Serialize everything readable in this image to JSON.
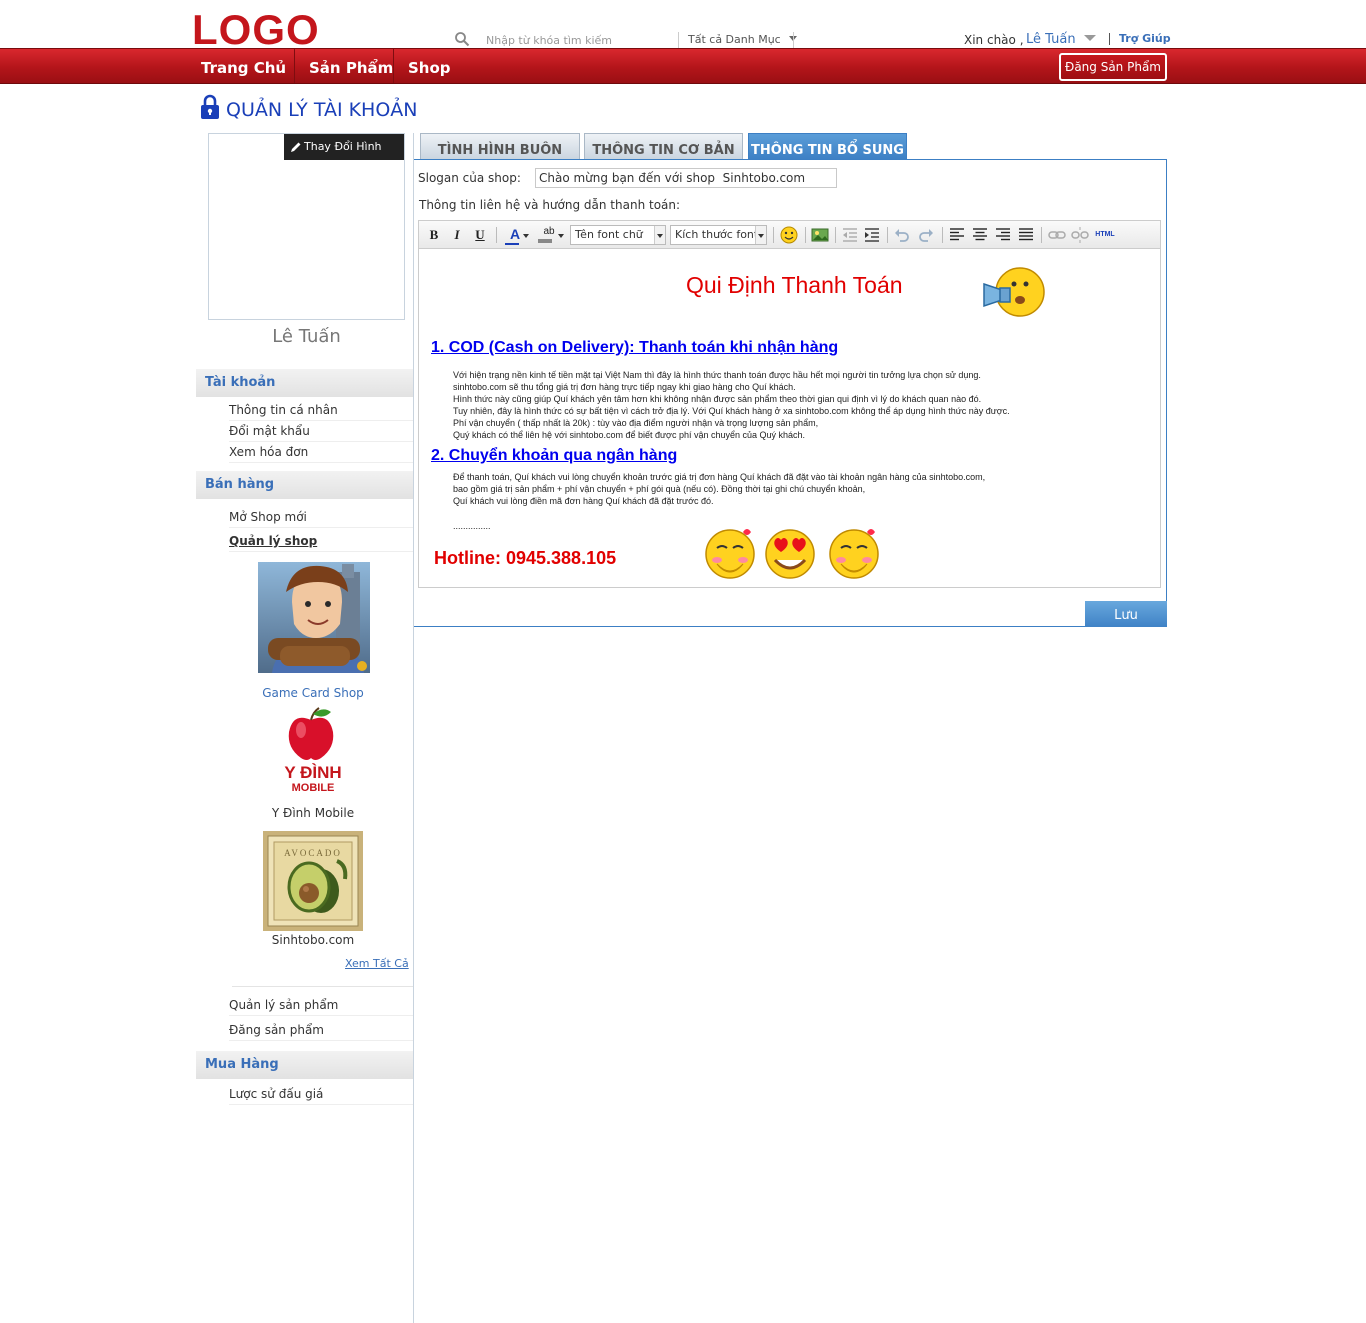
{
  "header": {
    "logo": "LOGO",
    "search_placeholder": "Nhập từ khóa tìm kiếm",
    "category": "Tất cả Danh Mục",
    "greeting": "Xin chào ,",
    "username": "Lê Tuấn",
    "help": "Trợ Giúp"
  },
  "nav": {
    "items": [
      "Trang Chủ",
      "Sản Phẩm",
      "Shop"
    ],
    "post_button": "Đăng Sản Phẩm"
  },
  "page_title": "QUẢN LÝ TÀI KHOẢN",
  "profile": {
    "change_photo": "Thay Đổi Hình Ảnh",
    "name": "Lê Tuấn"
  },
  "sidebar": {
    "account_head": "Tài khoản",
    "account_items": [
      "Thông tin cá nhân",
      "Đổi mật khẩu",
      "Xem hóa đơn"
    ],
    "sales_head": "Bán hàng",
    "sales_items": [
      "Mở Shop mới",
      "Quản lý shop"
    ],
    "shops": [
      {
        "name": "Game Card Shop",
        "color": "#3a6fb8"
      },
      {
        "name": "Y Đình Mobile",
        "color": "#333333",
        "logo_text": "Y ĐÌNH",
        "logo_sub": "MOBILE"
      },
      {
        "name": "Sinhtobo.com",
        "color": "#333333",
        "logo_text": "AVOCADO"
      }
    ],
    "see_all": "Xem Tất Cả",
    "sales_items_more": [
      "Quản lý sản phẩm",
      "Đăng sản phẩm"
    ],
    "buy_head": "Mua Hàng",
    "buy_items": [
      "Lược sử đấu giá"
    ]
  },
  "tabs": [
    "TÌNH HÌNH BUÔN BÁN",
    "THÔNG TIN CƠ BẢN",
    "THÔNG TIN BỔ SUNG"
  ],
  "form": {
    "slogan_label": "Slogan của shop:",
    "slogan_value": "Chào mừng bạn đến với shop  Sinhtobo.com",
    "contact_label": "Thông tin liên hệ và hướng dẫn thanh toán:"
  },
  "toolbar": {
    "bold": "B",
    "italic": "I",
    "underline": "U",
    "font_color": "A",
    "highlight": "ab",
    "font_name": "Tên font chữ",
    "font_size": "Kích thước font",
    "html": "HTML"
  },
  "document": {
    "title": "Qui Định Thanh Toán",
    "section1": "1. COD (Cash on Delivery):  Thanh toán khi nhận hàng",
    "section1_lines": [
      "  Với hiện trạng nền kinh tế tiền mặt tại Việt Nam thì đây là hình thức thanh toán được hầu hết mọi người tin tưởng lựa chọn sử dụng.",
      "sinhtobo.com sẽ thu tổng giá trị đơn hàng trực tiếp ngay khi giao hàng cho Quí khách.",
      "Hình thức này cũng giúp Quí khách yên tâm hơn khi không nhận được sản phẩm theo thời gian qui định vì lý do khách quan nào đó.",
      "Tuy nhiên, đây là hình thức có sự bất tiện vì cách trở địa lý. Với Quí khách hàng ở xa sinhtobo.com không thể áp dụng hình thức này được.",
      "Phí vận chuyển ( thấp nhất là 20k) : tùy vào địa điểm người nhận và trọng lượng sản phẩm,",
      "Quý khách có thể liên hệ với sinhtobo.com để biết được phí vận chuyển của Quý khách."
    ],
    "section2": "2. Chuyển khoản qua ngân hàng",
    "section2_lines": [
      "Để thanh toán, Quí khách vui lòng chuyển khoản trước giá trị đơn hàng Quí khách đã đặt vào tài khoản ngân hàng của sinhtobo.com,",
      "bao gồm giá trị sản phẩm + phí vận chuyển + phí gói quà (nếu có). Đồng thời tại ghi chú chuyển khoản,",
      "Quí khách vui lòng điền mã đơn hàng Quí khách đã đặt trước đó."
    ],
    "ellipsis": "...............",
    "hotline": "Hotline: 0945.388.105"
  },
  "save_button": "Lưu",
  "colors": {
    "brand_red": "#c4161c",
    "link_blue": "#3a6fb8",
    "tab_active": "#3c7fc4",
    "title_blue": "#1a3fb8"
  }
}
